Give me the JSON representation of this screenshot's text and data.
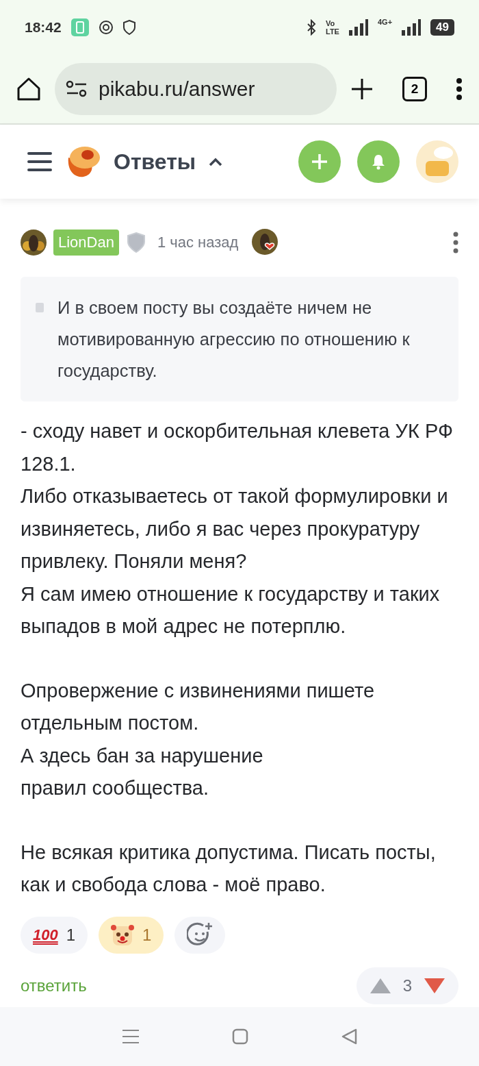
{
  "status_bar": {
    "time": "18:42",
    "volte_top": "Vo",
    "volte_bottom": "LTE",
    "network": "4G+",
    "battery": "49"
  },
  "browser": {
    "url": "pikabu.ru/answer",
    "tab_count": "2"
  },
  "header": {
    "section": "Ответы"
  },
  "comment": {
    "author": "LionDan",
    "time": "1 час назад",
    "quote": "И в своем посту вы создаёте ничем не мотивированную агрессию по отношению к государству.",
    "paragraphs": [
      [
        "- сходу навет и оскорбительная клевета УК РФ 128.1.",
        "Либо отказываетесь от такой формулировки и извиняетесь, либо я вас через прокуратуру привлеку. Поняли меня?",
        "Я сам имею отношение к государству и таких выпадов в мой адрес не потерплю."
      ],
      [
        "Опровержение с извинениями пишете отдельным постом.",
        "А здесь бан за нарушение",
        "правил сообщества."
      ],
      [
        "Не всякая критика допустима. Писать посты, как и свобода слова - моё право."
      ]
    ],
    "reactions": [
      {
        "kind": "hundred",
        "label": "100",
        "count": "1",
        "selected": false
      },
      {
        "kind": "clown",
        "count": "1",
        "selected": true
      }
    ],
    "reply": "ответить",
    "rating": "3",
    "downvoted": true
  }
}
